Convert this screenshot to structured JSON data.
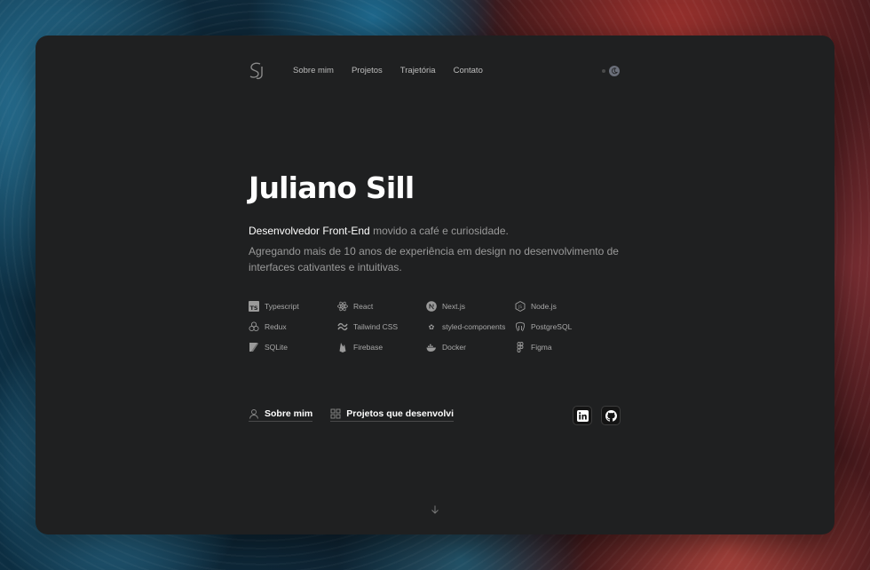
{
  "header": {
    "logo_icon": "sj-monogram-logo",
    "nav": [
      {
        "label": "Sobre mim"
      },
      {
        "label": "Projetos"
      },
      {
        "label": "Trajetória"
      },
      {
        "label": "Contato"
      }
    ],
    "theme_toggle": {
      "icons": [
        "sun-icon",
        "moon-icon"
      ],
      "state": "dark"
    }
  },
  "hero": {
    "name": "Juliano Sill",
    "tagline_strong": "Desenvolvedor Front-End",
    "tagline_rest": " movido a café e curiosidade.",
    "description": "Agregando mais de 10 anos de experiência em design no desenvolvimento de interfaces cativantes e intuitivas."
  },
  "tech": [
    {
      "label": "Typescript",
      "icon": "typescript-icon"
    },
    {
      "label": "React",
      "icon": "react-icon"
    },
    {
      "label": "Next.js",
      "icon": "nextjs-icon"
    },
    {
      "label": "Node.js",
      "icon": "nodejs-icon"
    },
    {
      "label": "Redux",
      "icon": "redux-icon"
    },
    {
      "label": "Tailwind CSS",
      "icon": "tailwind-icon"
    },
    {
      "label": "styled-components",
      "icon": "styled-components-icon"
    },
    {
      "label": "PostgreSQL",
      "icon": "postgresql-icon"
    },
    {
      "label": "SQLite",
      "icon": "sqlite-icon"
    },
    {
      "label": "Firebase",
      "icon": "firebase-icon"
    },
    {
      "label": "Docker",
      "icon": "docker-icon"
    },
    {
      "label": "Figma",
      "icon": "figma-icon"
    }
  ],
  "actions": {
    "about_label": "Sobre mim",
    "projects_label": "Projetos que desenvolvi"
  },
  "social": {
    "linkedin_icon": "linkedin-icon",
    "github_icon": "github-icon"
  },
  "colors": {
    "card_bg": "#1f2021",
    "text_primary": "#ffffff",
    "text_muted": "#9a9a9a"
  }
}
